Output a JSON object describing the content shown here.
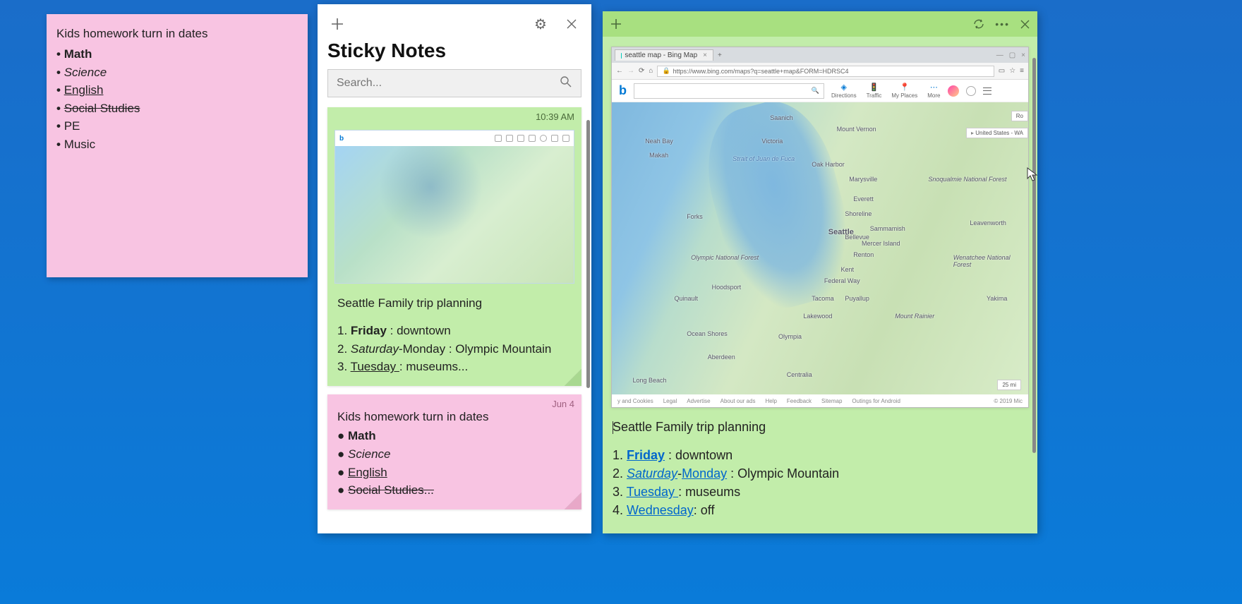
{
  "pink_note": {
    "title": "Kids homework turn in dates",
    "items": [
      {
        "text": "Math",
        "style": "bold"
      },
      {
        "text": "Science",
        "style": "italic"
      },
      {
        "text": "English",
        "style": "underline"
      },
      {
        "text": "Social Studies",
        "style": "strike"
      },
      {
        "text": "PE",
        "style": ""
      },
      {
        "text": "Music",
        "style": ""
      }
    ]
  },
  "hub": {
    "title": "Sticky Notes",
    "search_placeholder": "Search..."
  },
  "card_green": {
    "time": "10:39 AM",
    "heading": "Seattle Family trip planning",
    "items": [
      {
        "n": "1. ",
        "day": "Friday",
        "day_style": "bold",
        "rest": " : downtown"
      },
      {
        "n": "2. ",
        "day": "Saturday",
        "day_style": "italic",
        "rest": "-Monday : Olympic Mountain"
      },
      {
        "n": "3. ",
        "day": "Tuesday ",
        "day_style": "underline",
        "rest": ": museums..."
      }
    ]
  },
  "card_pink": {
    "time": "Jun 4",
    "heading": "Kids homework turn in dates",
    "items": [
      {
        "text": "Math",
        "style": "bold"
      },
      {
        "text": "Science",
        "style": "italic"
      },
      {
        "text": "English",
        "style": "underline"
      },
      {
        "text": "Social Studies...",
        "style": "strike"
      }
    ]
  },
  "open_note": {
    "tab_title": "seattle map - Bing Map",
    "url_text": "https://www.bing.com/maps?q=seattle+map&FORM=HDRSC4",
    "lock_icon": "🔒",
    "bing_items": {
      "directions": "Directions",
      "traffic": "Traffic",
      "places": "My Places",
      "more": "More"
    },
    "map_labels": {
      "victoria": "Victoria",
      "saanich": "Saanich",
      "mtvernon": "Mount Vernon",
      "oakharbor": "Oak Harbor",
      "marysville": "Marysville",
      "everett": "Everett",
      "seattle": "Seattle",
      "sammamish": "Sammamish",
      "mercer": "Mercer Island",
      "bellevue": "Bellevue",
      "renton": "Renton",
      "kent": "Kent",
      "fedway": "Federal Way",
      "tacoma": "Tacoma",
      "puyallup": "Puyallup",
      "olympia": "Olympia",
      "lakewood": "Lakewood",
      "shoreline": "Shoreline",
      "forks": "Forks",
      "neahbay": "Neah Bay",
      "makah": "Makah",
      "olympic": "Olympic National Forest",
      "snoq": "Snoqualmie National Forest",
      "rainier": "Mount Rainier",
      "hoodsport": "Hoodsport",
      "oceanshores": "Ocean Shores",
      "aberdeen": "Aberdeen",
      "centralia": "Centralia",
      "quinault": "Quinault",
      "yakima": "Yakima",
      "leavenworth": "Leavenworth",
      "wenatchee": "Wenatchee National Forest",
      "conconully": "Centralia",
      "juandefuca": "Strait of Juan de Fuca",
      "longbeach": "Long Beach"
    },
    "map_badges": {
      "ro": "Ro",
      "us": "United States - WA"
    },
    "map_scale": "25 mi",
    "map_footer": {
      "cookies": "y and Cookies",
      "legal": "Legal",
      "advertise": "Advertise",
      "ads": "About our ads",
      "help": "Help",
      "feedback": "Feedback",
      "sitemap": "Sitemap",
      "android": "Outings for Android",
      "copy": "© 2019 Mic"
    },
    "heading": "Seattle Family trip planning",
    "items": [
      {
        "n": "1. ",
        "day": "Friday",
        "day_class": "bold underline link",
        "rest": " : downtown"
      },
      {
        "n": "2. ",
        "pre": "Saturday",
        "pre_class": "italic underline link",
        "dash": "-",
        "day": "Monday",
        "day_class": "underline link",
        "rest": " : Olympic Mountain"
      },
      {
        "n": "3. ",
        "day": "Tuesday ",
        "day_class": "underline link",
        "rest": ": museums"
      },
      {
        "n": "4. ",
        "day": "Wednesday",
        "day_class": "strike underline link",
        "rest": ": off"
      }
    ]
  }
}
